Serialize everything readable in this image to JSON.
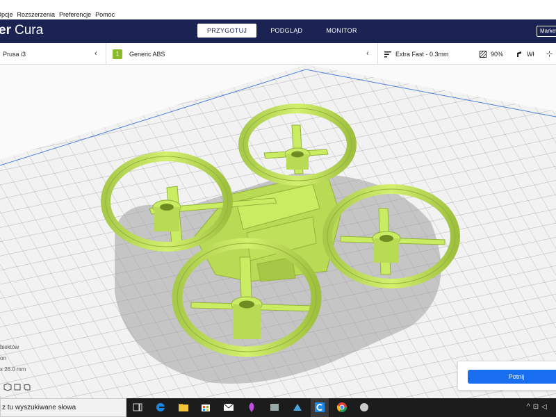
{
  "menu": [
    "Opcje",
    "Rozszerzenia",
    "Preferencje",
    "Pomoc"
  ],
  "app": {
    "logo_bold": "er",
    "logo_light": "Cura"
  },
  "tabs": [
    {
      "label": "PRZYGOTUJ",
      "active": true
    },
    {
      "label": "PODGLĄD",
      "active": false
    },
    {
      "label": "MONITOR",
      "active": false
    }
  ],
  "header": {
    "marketplace": "Marketplace"
  },
  "printer": {
    "name": "Prusa i3"
  },
  "material": {
    "name": "Generic ABS"
  },
  "print_settings": {
    "profile": "Extra Fast - 0.3mm",
    "infill": "90%",
    "support": "Wł"
  },
  "object_info": {
    "line1": "biektów",
    "line2": "on",
    "line3": "x 26.0 mm"
  },
  "slice": {
    "button": "Potnij"
  },
  "taskbar": {
    "search": "z tu wyszukiwane słowa"
  },
  "colors": {
    "header": "#1a2352",
    "model": "#c9ec63",
    "slice_button": "#196ef0",
    "material": "#8bba2a"
  }
}
